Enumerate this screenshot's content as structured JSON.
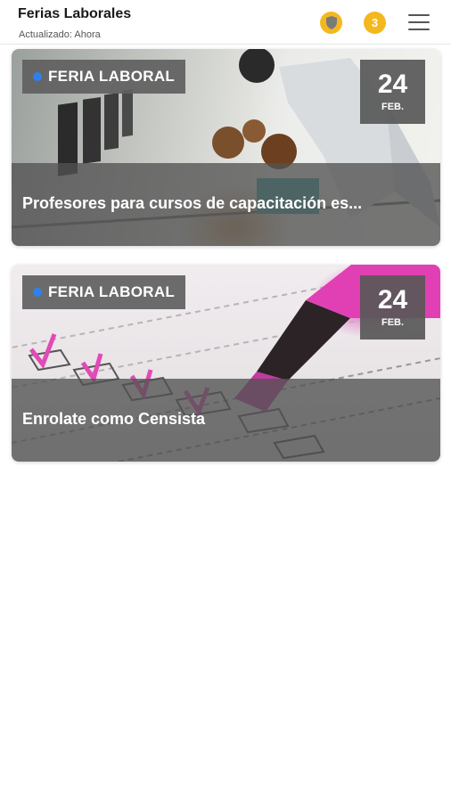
{
  "header": {
    "title": "Ferias Laborales",
    "subtitle": "Actualizado: Ahora",
    "shield_icon": "shield-icon",
    "count": "3",
    "menu_icon": "menu-icon",
    "accent_color": "#f4b81f"
  },
  "cards": [
    {
      "tag": "FERIA LABORAL",
      "day": "24",
      "month": "FEB.",
      "title": "Profesores para cursos de capacitación es...",
      "image": "classroom-photo"
    },
    {
      "tag": "FERIA LABORAL",
      "day": "24",
      "month": "FEB.",
      "title": "Enrolate como Censista",
      "image": "checklist-highlighter-photo"
    }
  ],
  "colors": {
    "tag_dot": "#2f80ed",
    "overlay": "#525252"
  }
}
